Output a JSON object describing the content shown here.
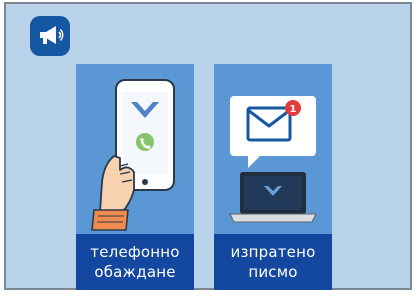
{
  "badge": {
    "icon": "megaphone-icon",
    "color": "#1657a4"
  },
  "cards": [
    {
      "icon": "phone-call-icon",
      "line1": "телефонно",
      "line2": "обаждане"
    },
    {
      "icon": "email-notification-icon",
      "line1": "изпратено",
      "line2": "писмо",
      "notification_count": "1"
    }
  ],
  "colors": {
    "background": "#b8d3ea",
    "card": "#5a97d4",
    "caption": "#1448a0"
  }
}
